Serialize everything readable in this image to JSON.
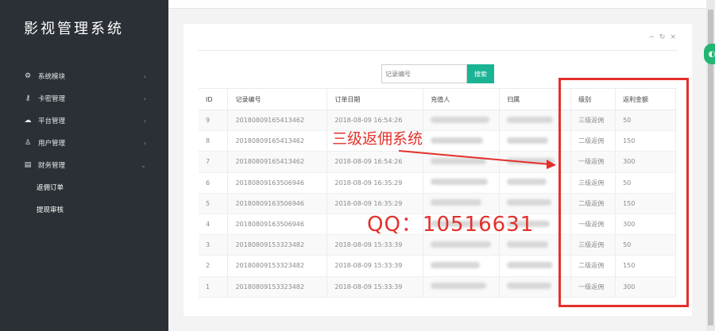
{
  "app": {
    "title": "影视管理系统"
  },
  "sidebar": {
    "items": [
      {
        "label": "系统模块",
        "icon": "gear-icon",
        "glyph": "⚙"
      },
      {
        "label": "卡密管理",
        "icon": "key-icon",
        "glyph": "⚷"
      },
      {
        "label": "平台管理",
        "icon": "cloud-icon",
        "glyph": "☁"
      },
      {
        "label": "用户管理",
        "icon": "user-icon",
        "glyph": "♙"
      },
      {
        "label": "财务管理",
        "icon": "wallet-icon",
        "glyph": "▤"
      }
    ],
    "subitems": [
      {
        "label": "返佣订单"
      },
      {
        "label": "提现审核"
      }
    ]
  },
  "panel": {
    "tools": [
      "−",
      "↻",
      "×"
    ]
  },
  "search": {
    "placeholder": "记录编号",
    "button_label": "搜索"
  },
  "table": {
    "columns": [
      "ID",
      "记录编号",
      "订单日期",
      "充值人",
      "归属",
      "级别",
      "返利金额"
    ],
    "rows": [
      {
        "id": "9",
        "record": "20180809165413462",
        "date": "2018-08-09 16:54:26",
        "level": "三级返佣",
        "amount": "50"
      },
      {
        "id": "8",
        "record": "20180809165413462",
        "date": "",
        "level": "二级返佣",
        "amount": "150"
      },
      {
        "id": "7",
        "record": "20180809165413462",
        "date": "2018-08-09 16:54:26",
        "level": "一级返佣",
        "amount": "300"
      },
      {
        "id": "6",
        "record": "20180809163506946",
        "date": "2018-08-09 16:35:29",
        "level": "三级返佣",
        "amount": "50"
      },
      {
        "id": "5",
        "record": "20180809163506946",
        "date": "2018-08-09 16:35:29",
        "level": "二级返佣",
        "amount": "150"
      },
      {
        "id": "4",
        "record": "20180809163506946",
        "date": "",
        "level": "一级返佣",
        "amount": "300"
      },
      {
        "id": "3",
        "record": "20180809153323482",
        "date": "2018-08-09 15:33:39",
        "level": "三级返佣",
        "amount": "50"
      },
      {
        "id": "2",
        "record": "20180809153323482",
        "date": "2018-08-09 15:33:39",
        "level": "二级返佣",
        "amount": "150"
      },
      {
        "id": "1",
        "record": "20180809153323482",
        "date": "2018-08-09 15:33:39",
        "level": "一级返佣",
        "amount": "300"
      }
    ]
  },
  "annotation": {
    "label": "三级返佣系统",
    "qq": "QQ：10516631",
    "color": "#e3302b"
  },
  "float_badge": {
    "glyph": "◐"
  }
}
